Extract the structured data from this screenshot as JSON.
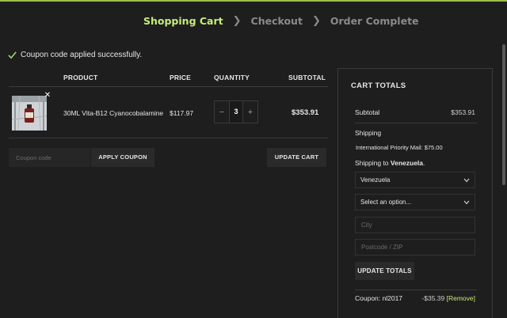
{
  "steps": {
    "cart": "Shopping Cart",
    "checkout": "Checkout",
    "complete": "Order Complete"
  },
  "notice": {
    "text": "Coupon code applied successfully."
  },
  "table": {
    "headers": {
      "product": "PRODUCT",
      "price": "PRICE",
      "quantity": "QUANTITY",
      "subtotal": "SUBTOTAL"
    },
    "items": [
      {
        "name": "30ML Vita-B12 Cyanocobalamine",
        "price": "$117.97",
        "quantity": "3",
        "subtotal": "$353.91"
      }
    ]
  },
  "coupon": {
    "placeholder": "Coupon code",
    "apply_label": "APPLY COUPON"
  },
  "update_cart_label": "UPDATE CART",
  "totals": {
    "title": "CART TOTALS",
    "subtotal_label": "Subtotal",
    "subtotal_value": "$353.91",
    "shipping_label": "Shipping",
    "shipping_method": "International Priority Mail: $75.00",
    "shipping_to_prefix": "Shipping to",
    "shipping_to_country": "Venezuela",
    "country_select": "Venezuela",
    "state_select": "Select an option...",
    "city_placeholder": "City",
    "postcode_placeholder": "Postcode / ZIP",
    "update_totals_label": "UPDATE TOTALS",
    "coupon_label": "Coupon: nl2017",
    "coupon_discount": "-$35.39",
    "coupon_remove": "[Remove]"
  },
  "colors": {
    "accent": "#c8ec7a",
    "background": "#1e1e1e",
    "border": "#3a3a3a"
  }
}
